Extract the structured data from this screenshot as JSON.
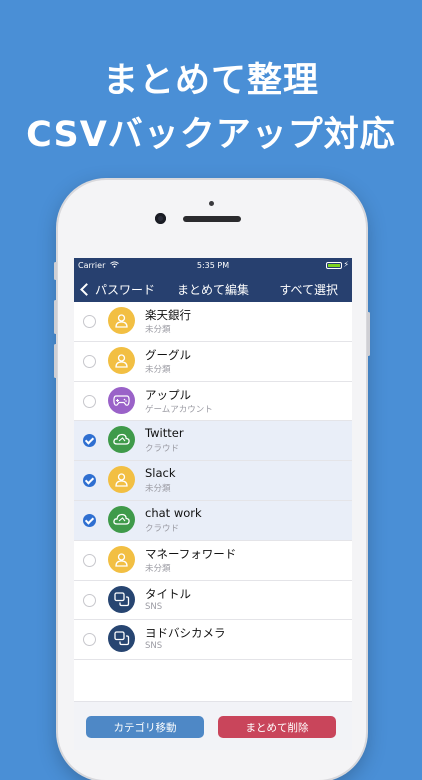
{
  "headline": {
    "line1": "まとめて整理",
    "line2": "CSVバックアップ対応"
  },
  "statusbar": {
    "carrier": "Carrier",
    "time": "5:35 PM"
  },
  "navbar": {
    "back_label": "パスワード",
    "title": "まとめて編集",
    "select_all": "すべて選択"
  },
  "items": [
    {
      "name": "楽天銀行",
      "category": "未分類",
      "selected": false,
      "icon": "person-icon",
      "color": "#f2bf43"
    },
    {
      "name": "グーグル",
      "category": "未分類",
      "selected": false,
      "icon": "person-icon",
      "color": "#f2bf43"
    },
    {
      "name": "アップル",
      "category": "ゲームアカウント",
      "selected": false,
      "icon": "gamepad-icon",
      "color": "#9a62c8"
    },
    {
      "name": "Twitter",
      "category": "クラウド",
      "selected": true,
      "icon": "cloud-icon",
      "color": "#3f9a4a"
    },
    {
      "name": "Slack",
      "category": "未分類",
      "selected": true,
      "icon": "person-icon",
      "color": "#f2bf43"
    },
    {
      "name": "chat work",
      "category": "クラウド",
      "selected": true,
      "icon": "cloud-icon",
      "color": "#3f9a4a"
    },
    {
      "name": "マネーフォワード",
      "category": "未分類",
      "selected": false,
      "icon": "person-icon",
      "color": "#f2bf43"
    },
    {
      "name": "タイトル",
      "category": "SNS",
      "selected": false,
      "icon": "chat-bubbles-icon",
      "color": "#274571"
    },
    {
      "name": "ヨドバシカメラ",
      "category": "SNS",
      "selected": false,
      "icon": "chat-bubbles-icon",
      "color": "#274571"
    }
  ],
  "footer": {
    "move_label": "カテゴリ移動",
    "delete_label": "まとめて削除"
  },
  "colors": {
    "background": "#4a8fd6",
    "navbar": "#27406f",
    "selected_row": "#e9eef8",
    "check": "#2f6fd1",
    "move_button": "#4e88c6",
    "delete_button": "#c9455b"
  }
}
